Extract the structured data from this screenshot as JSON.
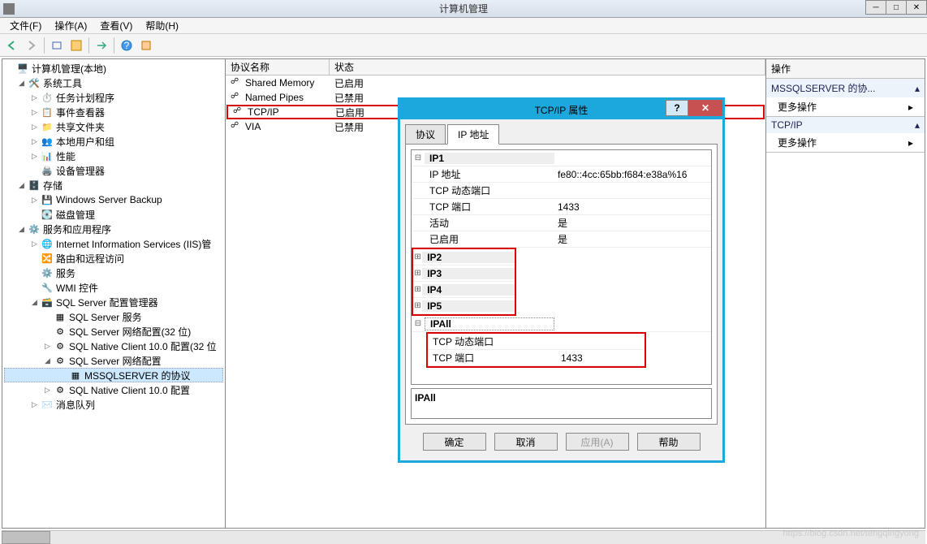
{
  "window": {
    "title": "计算机管理"
  },
  "menu": {
    "file": "文件(F)",
    "action": "操作(A)",
    "view": "查看(V)",
    "help": "帮助(H)"
  },
  "tree": {
    "root": "计算机管理(本地)",
    "system_tools": "系统工具",
    "task_scheduler": "任务计划程序",
    "event_viewer": "事件查看器",
    "shared_folders": "共享文件夹",
    "local_users": "本地用户和组",
    "performance": "性能",
    "device_mgr": "设备管理器",
    "storage": "存储",
    "wsb": "Windows Server Backup",
    "disk_mgmt": "磁盘管理",
    "services_apps": "服务和应用程序",
    "iis": "Internet Information Services (IIS)管",
    "routing": "路由和远程访问",
    "services": "服务",
    "wmi": "WMI 控件",
    "sql_config": "SQL Server 配置管理器",
    "sql_services": "SQL Server 服务",
    "sql_net32": "SQL Server 网络配置(32 位)",
    "sql_native32": "SQL Native Client 10.0 配置(32 位",
    "sql_net": "SQL Server 网络配置",
    "mssql_proto": "MSSQLSERVER 的协议",
    "sql_native": "SQL Native Client 10.0 配置",
    "msmq": "消息队列"
  },
  "list": {
    "col_name": "协议名称",
    "col_status": "状态",
    "rows": [
      {
        "name": "Shared Memory",
        "status": "已启用"
      },
      {
        "name": "Named Pipes",
        "status": "已禁用"
      },
      {
        "name": "TCP/IP",
        "status": "已启用"
      },
      {
        "name": "VIA",
        "status": "已禁用"
      }
    ]
  },
  "actions": {
    "header": "操作",
    "sec1": "MSSQLSERVER 的协...",
    "more1": "更多操作",
    "sec2": "TCP/IP",
    "more2": "更多操作"
  },
  "dialog": {
    "title": "TCP/IP 属性",
    "tab_proto": "协议",
    "tab_ip": "IP 地址",
    "ip1": "IP1",
    "ip_addr_label": "IP 地址",
    "ip_addr_val": "fe80::4cc:65bb:f684:e38a%16",
    "tcp_dyn_label": "TCP 动态端口",
    "tcp_dyn_val": "",
    "tcp_port_label": "TCP 端口",
    "tcp_port_val": "1433",
    "active_label": "活动",
    "active_val": "是",
    "enabled_label": "已启用",
    "enabled_val": "是",
    "ip2": "IP2",
    "ip3": "IP3",
    "ip4": "IP4",
    "ip5": "IP5",
    "ipall": "IPAll",
    "ipall_dyn": "TCP 动态端口",
    "ipall_port_label": "TCP 端口",
    "ipall_port_val": "1433",
    "desc": "IPAll",
    "ok": "确定",
    "cancel": "取消",
    "apply": "应用(A)",
    "help": "帮助"
  },
  "watermark": "https://blog.csdn.net/tengqingyong"
}
